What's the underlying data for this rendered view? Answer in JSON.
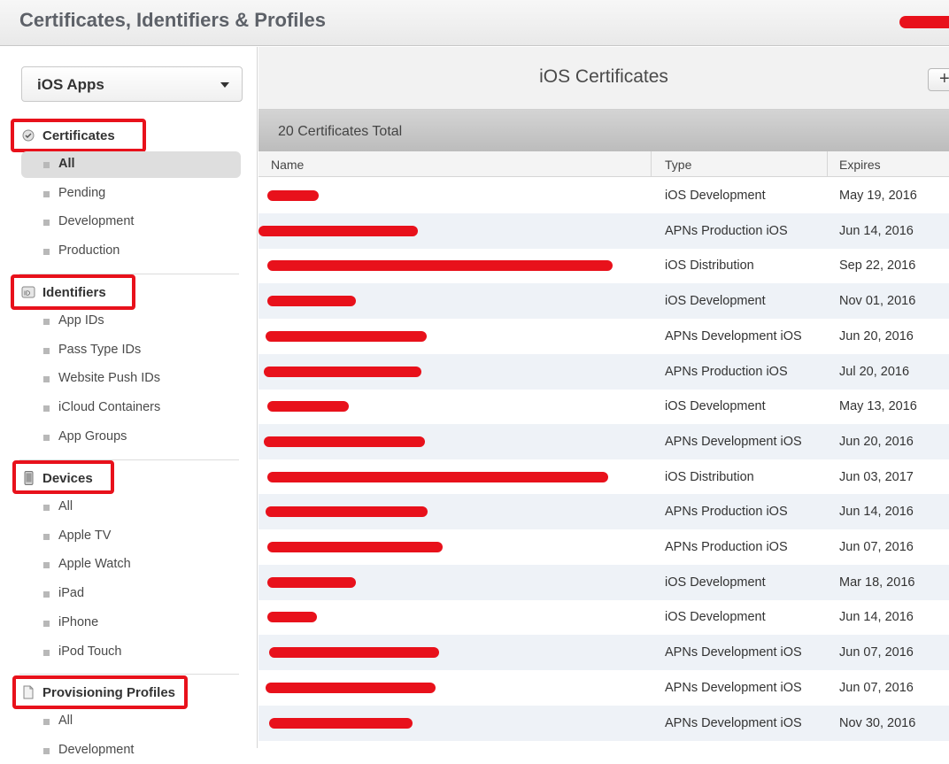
{
  "header": {
    "title": "Certificates, Identifiers & Profiles"
  },
  "sidebar": {
    "platform_select": "iOS Apps",
    "sections": [
      {
        "title": "Certificates",
        "icon": "certificate-icon",
        "items": [
          {
            "label": "All",
            "active": true
          },
          {
            "label": "Pending"
          },
          {
            "label": "Development"
          },
          {
            "label": "Production"
          }
        ]
      },
      {
        "title": "Identifiers",
        "icon": "id-badge-icon",
        "items": [
          {
            "label": "App IDs"
          },
          {
            "label": "Pass Type IDs"
          },
          {
            "label": "Website Push IDs"
          },
          {
            "label": "iCloud Containers"
          },
          {
            "label": "App Groups"
          }
        ]
      },
      {
        "title": "Devices",
        "icon": "device-icon",
        "items": [
          {
            "label": "All"
          },
          {
            "label": "Apple TV"
          },
          {
            "label": "Apple Watch"
          },
          {
            "label": "iPad"
          },
          {
            "label": "iPhone"
          },
          {
            "label": "iPod Touch"
          }
        ]
      },
      {
        "title": "Provisioning Profiles",
        "icon": "document-icon",
        "items": [
          {
            "label": "All"
          },
          {
            "label": "Development"
          }
        ]
      }
    ]
  },
  "main": {
    "title": "iOS Certificates",
    "add_label": "+",
    "total": "20 Certificates Total",
    "columns": {
      "name": "Name",
      "type": "Type",
      "expires": "Expires"
    },
    "rows": [
      {
        "type": "iOS Development",
        "expires": "May 19, 2016"
      },
      {
        "type": "APNs Production iOS",
        "expires": "Jun 14, 2016"
      },
      {
        "type": "iOS Distribution",
        "expires": "Sep 22, 2016"
      },
      {
        "type": "iOS Development",
        "expires": "Nov 01, 2016"
      },
      {
        "type": "APNs Development iOS",
        "expires": "Jun 20, 2016"
      },
      {
        "type": "APNs Production iOS",
        "expires": "Jul 20, 2016"
      },
      {
        "type": "iOS Development",
        "expires": "May 13, 2016"
      },
      {
        "type": "APNs Development iOS",
        "expires": "Jun 20, 2016"
      },
      {
        "type": "iOS Distribution",
        "expires": "Jun 03, 2017"
      },
      {
        "type": "APNs Production iOS",
        "expires": "Jun 14, 2016"
      },
      {
        "type": "APNs Production iOS",
        "expires": "Jun 07, 2016"
      },
      {
        "type": "iOS Development",
        "expires": "Mar 18, 2016"
      },
      {
        "type": "iOS Development",
        "expires": "Jun 14, 2016"
      },
      {
        "type": "APNs Development iOS",
        "expires": "Jun 07, 2016"
      },
      {
        "type": "APNs Development iOS",
        "expires": "Jun 07, 2016"
      },
      {
        "type": "APNs Development iOS",
        "expires": "Nov 30, 2016"
      }
    ]
  },
  "colors": {
    "highlight": "#e8111b",
    "row_alt": "#eef2f7"
  }
}
